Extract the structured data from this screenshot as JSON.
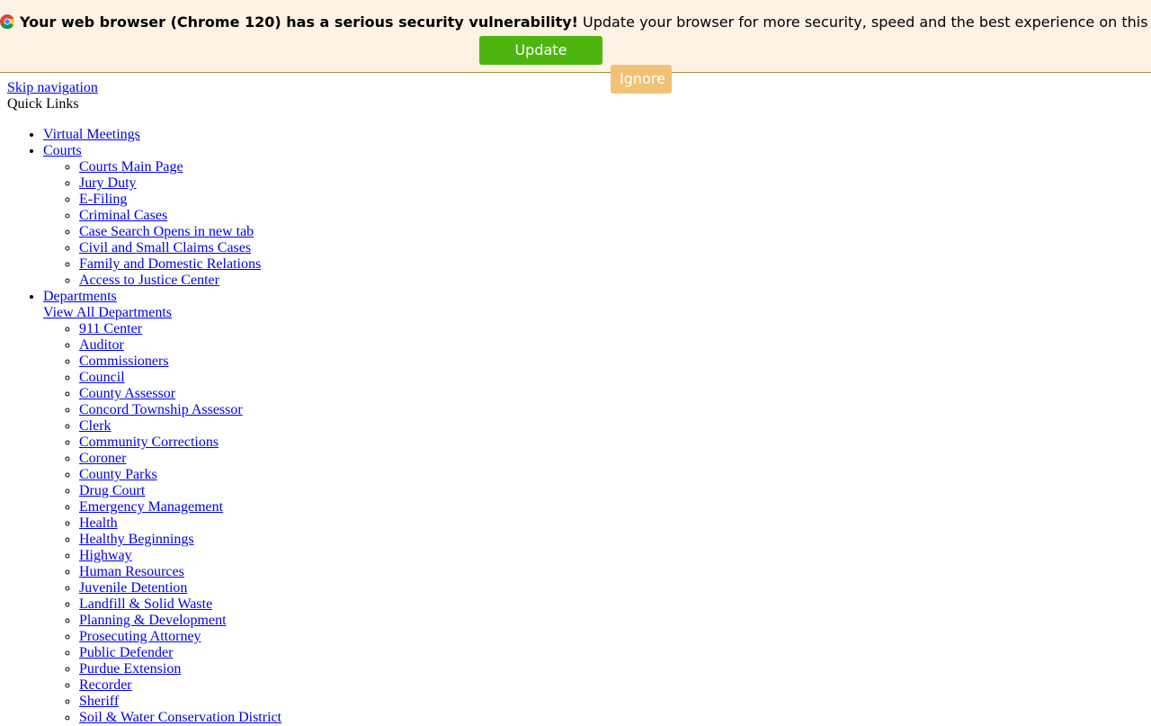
{
  "banner": {
    "strong_text": "Your web browser (Chrome 120) has a serious security vulnerability!",
    "message_text": "Update your browser for more security, speed and the best experience on this site.",
    "update_label": "Update browser",
    "ignore_label": "Ignore",
    "icon": "chrome-icon",
    "colors": {
      "background": "#fdf3e5",
      "border": "#a6883c",
      "update_button": "#4cb60f",
      "ignore_button": "#f0c275"
    }
  },
  "page": {
    "skip_nav_label": "Skip navigation",
    "quick_links_heading": "Quick Links",
    "link_color": "#0000ee"
  },
  "nav": {
    "virtual_meetings": "Virtual Meetings",
    "courts": {
      "label": "Courts",
      "items": [
        "Courts Main Page",
        "Jury Duty",
        "E-Filing",
        "Criminal Cases",
        "Case Search Opens in new tab",
        "Civil and Small Claims Cases",
        "Family and Domestic Relations",
        "Access to Justice Center"
      ]
    },
    "departments": {
      "label": "Departments",
      "view_all": "View All Departments",
      "items": [
        "911 Center",
        "Auditor",
        "Commissioners",
        "Council",
        "County Assessor",
        "Concord Township Assessor",
        "Clerk",
        "Community Corrections",
        "Coroner",
        "County Parks",
        "Drug Court",
        "Emergency Management",
        "Health",
        "Healthy Beginnings",
        "Highway",
        "Human Resources",
        "Juvenile Detention",
        "Landfill & Solid Waste",
        "Planning & Development",
        "Prosecuting Attorney",
        "Public Defender",
        "Purdue Extension",
        "Recorder",
        "Sheriff",
        "Soil & Water Conservation District"
      ]
    }
  }
}
